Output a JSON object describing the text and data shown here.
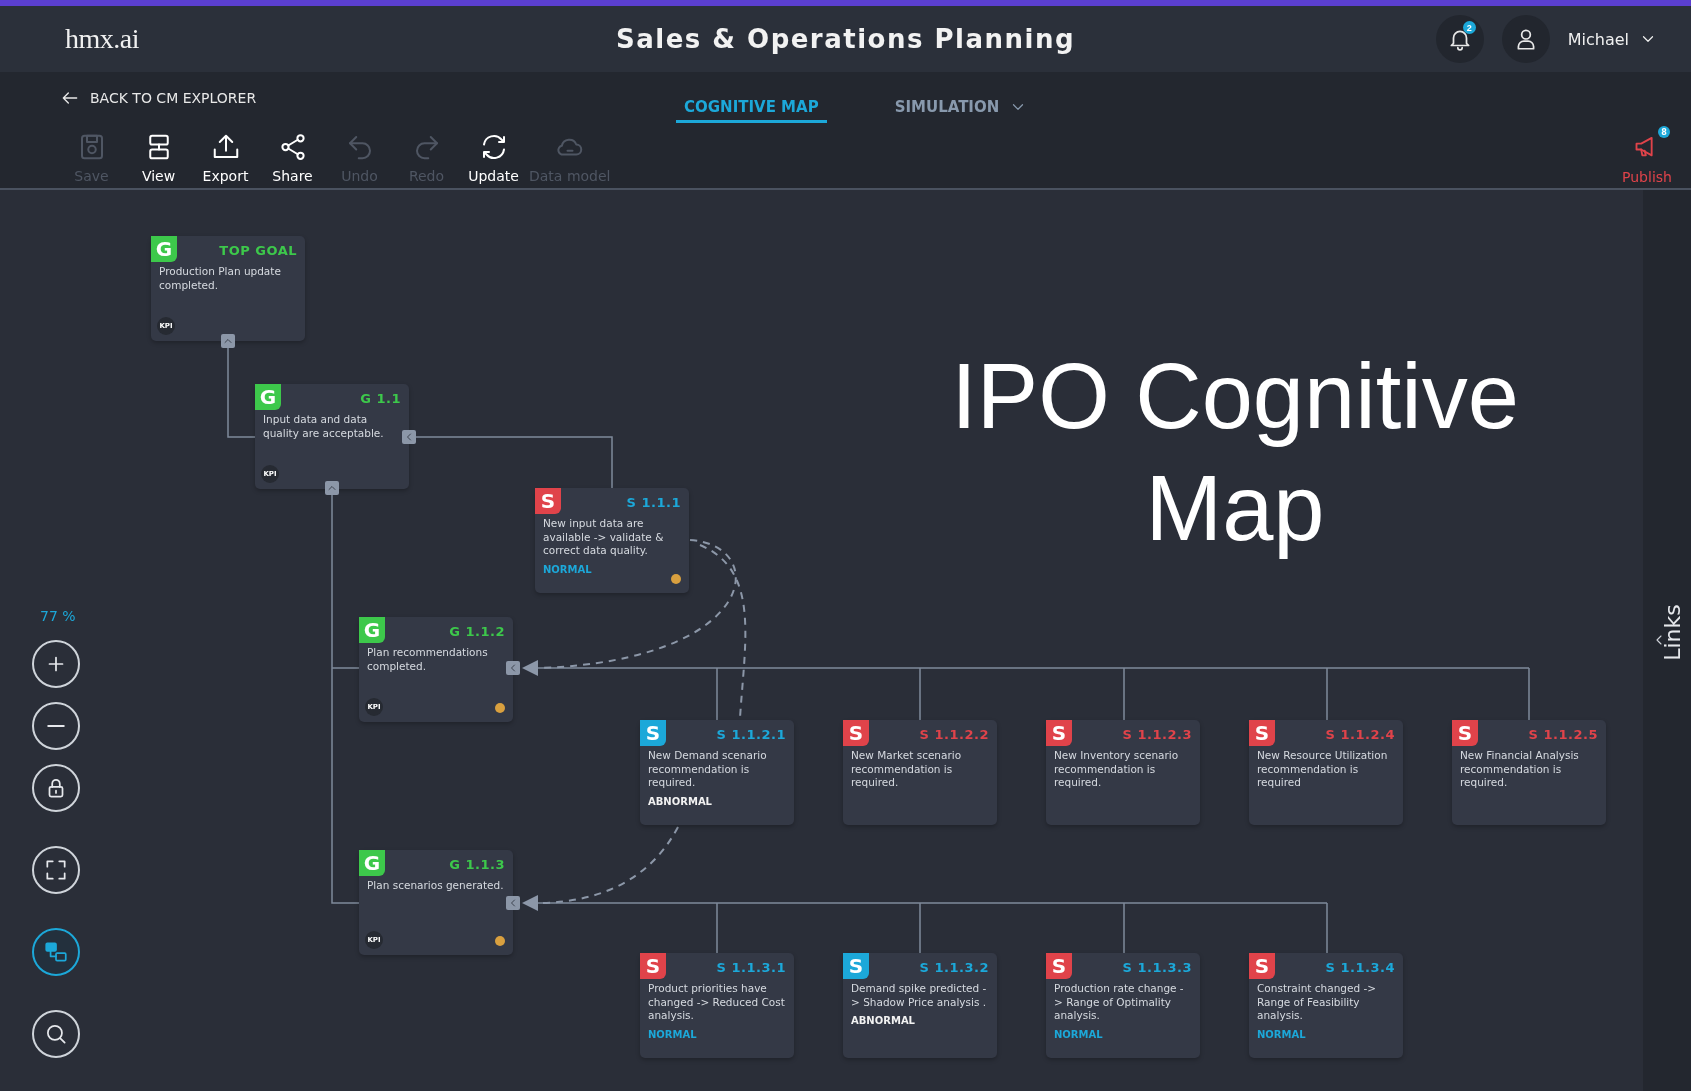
{
  "header": {
    "logo": "hmx.ai",
    "title": "Sales & Operations Planning",
    "notifications": "2",
    "user": "Michael"
  },
  "back_link": "BACK TO CM EXPLORER",
  "tabs": [
    {
      "label": "COGNITIVE MAP",
      "selected": true,
      "dropdown": false
    },
    {
      "label": "SIMULATION",
      "selected": false,
      "dropdown": true
    }
  ],
  "toolbar": [
    {
      "label": "Save",
      "disabled": true
    },
    {
      "label": "View",
      "disabled": false
    },
    {
      "label": "Export",
      "disabled": false
    },
    {
      "label": "Share",
      "disabled": false
    },
    {
      "label": "Undo",
      "disabled": true
    },
    {
      "label": "Redo",
      "disabled": true
    },
    {
      "label": "Update",
      "disabled": false
    },
    {
      "label": "Data model",
      "disabled": true
    }
  ],
  "publish": {
    "label": "Publish",
    "badge": "8"
  },
  "zoom_controls": {
    "zoom": "77 %",
    "tools": [
      {
        "selected": false
      },
      {
        "selected": false
      },
      {
        "selected": false
      },
      {
        "selected": false
      },
      {
        "selected": true
      },
      {
        "selected": false
      }
    ]
  },
  "nodes": [
    {
      "badge": {
        "letter": "G",
        "color": "#3dc84b"
      },
      "code": {
        "text": "TOP GOAL",
        "color": "#3dc84b"
      },
      "text": "Production Plan update completed.",
      "kpi": "KPI",
      "alert": false
    },
    {
      "badge": {
        "letter": "G",
        "color": "#3dc84b"
      },
      "code": {
        "text": "G 1.1",
        "color": "#3dc84b"
      },
      "text": "Input data and data quality are acceptable.",
      "kpi": "KPI",
      "alert": false
    },
    {
      "badge": {
        "letter": "S",
        "color": "#e0434a"
      },
      "code": {
        "text": "S 1.1.1",
        "color": "#1ca8d9"
      },
      "text": "New input data are available -> validate & correct data quality.",
      "status": {
        "text": "NORMAL",
        "kind": "normal"
      },
      "alert": true
    },
    {
      "badge": {
        "letter": "G",
        "color": "#3dc84b"
      },
      "code": {
        "text": "G 1.1.2",
        "color": "#3dc84b"
      },
      "text": "Plan recommendations completed.",
      "kpi": "KPI",
      "alert": true
    },
    {
      "badge": {
        "letter": "G",
        "color": "#3dc84b"
      },
      "code": {
        "text": "G 1.1.3",
        "color": "#3dc84b"
      },
      "text": "Plan scenarios generated.",
      "kpi": "KPI",
      "alert": true
    },
    {
      "badge": {
        "letter": "S",
        "color": "#1ca8d9"
      },
      "code": {
        "text": "S 1.1.2.1",
        "color": "#1ca8d9"
      },
      "text": "New Demand scenario recommendation is required.",
      "status": {
        "text": "ABNORMAL",
        "kind": "abnormal"
      },
      "alert": false
    },
    {
      "badge": {
        "letter": "S",
        "color": "#e0434a"
      },
      "code": {
        "text": "S 1.1.2.2",
        "color": "#e0434a"
      },
      "text": "New Market scenario recommendation is required.",
      "alert": false
    },
    {
      "badge": {
        "letter": "S",
        "color": "#e0434a"
      },
      "code": {
        "text": "S 1.1.2.3",
        "color": "#e0434a"
      },
      "text": "New Inventory scenario recommendation is required.",
      "alert": false
    },
    {
      "badge": {
        "letter": "S",
        "color": "#e0434a"
      },
      "code": {
        "text": "S 1.1.2.4",
        "color": "#e0434a"
      },
      "text": "New Resource Utilization recommendation is required",
      "alert": false
    },
    {
      "badge": {
        "letter": "S",
        "color": "#e0434a"
      },
      "code": {
        "text": "S 1.1.2.5",
        "color": "#e0434a"
      },
      "text": "New Financial Analysis recommendation is required.",
      "alert": false
    },
    {
      "badge": {
        "letter": "S",
        "color": "#e0434a"
      },
      "code": {
        "text": "S 1.1.3.1",
        "color": "#1ca8d9"
      },
      "text": "Product priorities have changed -> Reduced Cost analysis.",
      "status": {
        "text": "NORMAL",
        "kind": "normal"
      },
      "alert": false
    },
    {
      "badge": {
        "letter": "S",
        "color": "#1ca8d9"
      },
      "code": {
        "text": "S 1.1.3.2",
        "color": "#1ca8d9"
      },
      "text": "Demand spike predicted -> Shadow Price analysis .",
      "status": {
        "text": "ABNORMAL",
        "kind": "abnormal"
      },
      "alert": false
    },
    {
      "badge": {
        "letter": "S",
        "color": "#e0434a"
      },
      "code": {
        "text": "S 1.1.3.3",
        "color": "#1ca8d9"
      },
      "text": "Production rate change -> Range of Optimality analysis.",
      "status": {
        "text": "NORMAL",
        "kind": "normal"
      },
      "alert": false
    },
    {
      "badge": {
        "letter": "S",
        "color": "#e0434a"
      },
      "code": {
        "text": "S 1.1.3.4",
        "color": "#1ca8d9"
      },
      "text": "Constraint changed -> Range of Feasibility analysis.",
      "status": {
        "text": "NORMAL",
        "kind": "normal"
      },
      "alert": false
    }
  ],
  "overlay_title": "IPO Cognitive Map",
  "side_panel": {
    "label": "Links"
  }
}
